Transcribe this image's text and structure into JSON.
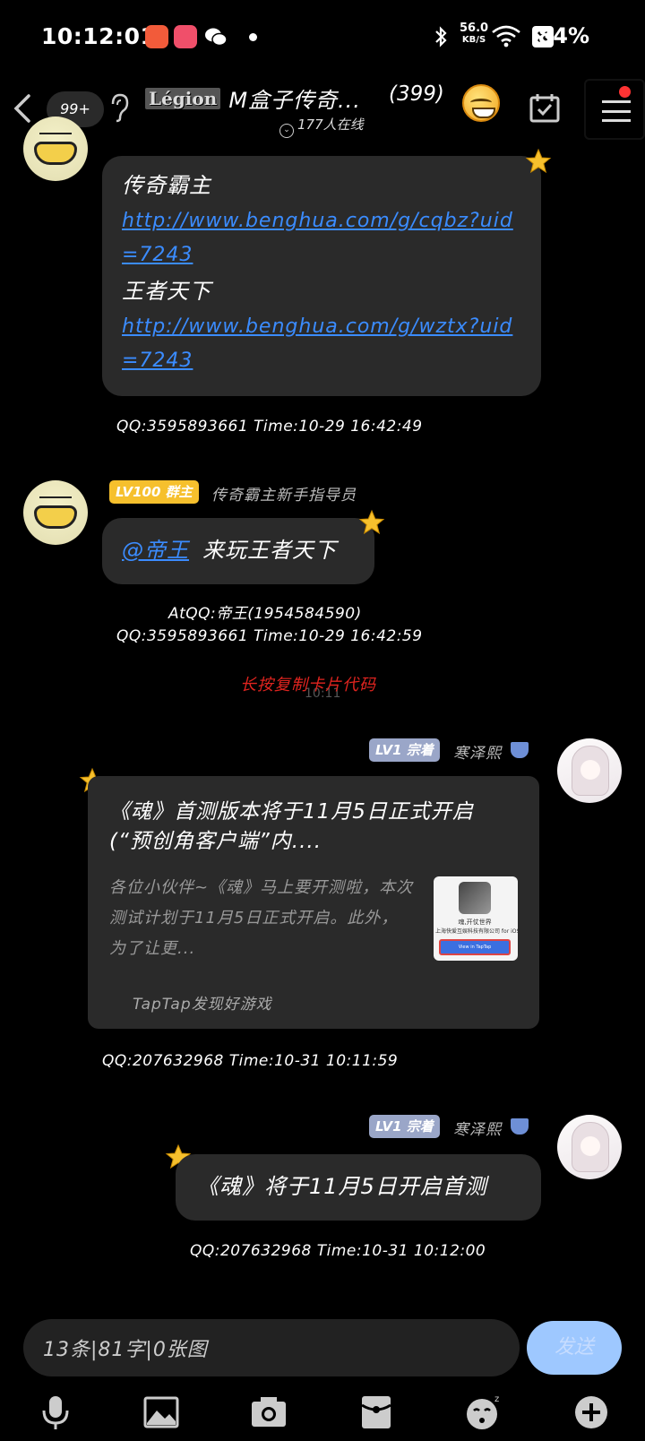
{
  "status_bar": {
    "time": "10:12:01",
    "net_speed": "56.0",
    "net_unit": "KB/S",
    "battery": "84%"
  },
  "header": {
    "unread": "99+",
    "logo_text": "Légion",
    "title": "M盒子传奇...",
    "member_count": "(399)",
    "online": "177人在线"
  },
  "messages": [
    {
      "lines": [
        {
          "type": "text",
          "text": "传奇霸主"
        },
        {
          "type": "link",
          "text": "http://www.benghua.com/g/cqbz?uid=7243"
        },
        {
          "type": "text",
          "text": "王者天下"
        },
        {
          "type": "link",
          "text": "http://www.benghua.com/g/wztx?uid=7243"
        }
      ],
      "meta": "QQ:3595893661 Time:10-29 16:42:49"
    },
    {
      "badge": "LV100 群主",
      "nick": "传奇霸主新手指导员",
      "mention": "@帝王",
      "text": "来玩王者天下",
      "meta_at": "AtQQ:帝王(1954584590)",
      "meta": "QQ:3595893661 Time:10-29 16:42:59"
    },
    {
      "badge": "LV1 宗着",
      "nick": "寒泽熙",
      "card_title": "《魂》首测版本将于11月5日正式开启(“预创角客户端”内....",
      "card_desc": "各位小伙伴~《魂》马上要开测啦，本次测试计划于11月5日正式开启。此外，为了让更...",
      "thumb_caption": "魂,开仗世界",
      "thumb_company": "上海快爱互娱科技有限公司 for iOS",
      "thumb_button": "View in TapTap",
      "card_source": "TapTap发现好游戏",
      "meta": "QQ:207632968 Time:10-31 10:11:59"
    },
    {
      "badge": "LV1 宗着",
      "nick": "寒泽熙",
      "text": "《魂》将于11月5日开启首测",
      "meta": "QQ:207632968 Time:10-31 10:12:00"
    }
  ],
  "system": {
    "hint": "长按复制卡片代码",
    "time": "10:11"
  },
  "input": {
    "placeholder": "13条|81字|0张图",
    "send_label": "发送"
  },
  "toolbar": [
    "microphone-icon",
    "image-icon",
    "camera-icon",
    "red-packet-icon",
    "sticker-icon",
    "plus-icon"
  ],
  "colors": {
    "bubble": "#2a2a2a",
    "link": "#3b8cff",
    "badge_gold": "#f6c02d",
    "badge_grey": "#9aa6c8",
    "hint_red": "#e0241f",
    "send_button": "#9ec8ff"
  }
}
